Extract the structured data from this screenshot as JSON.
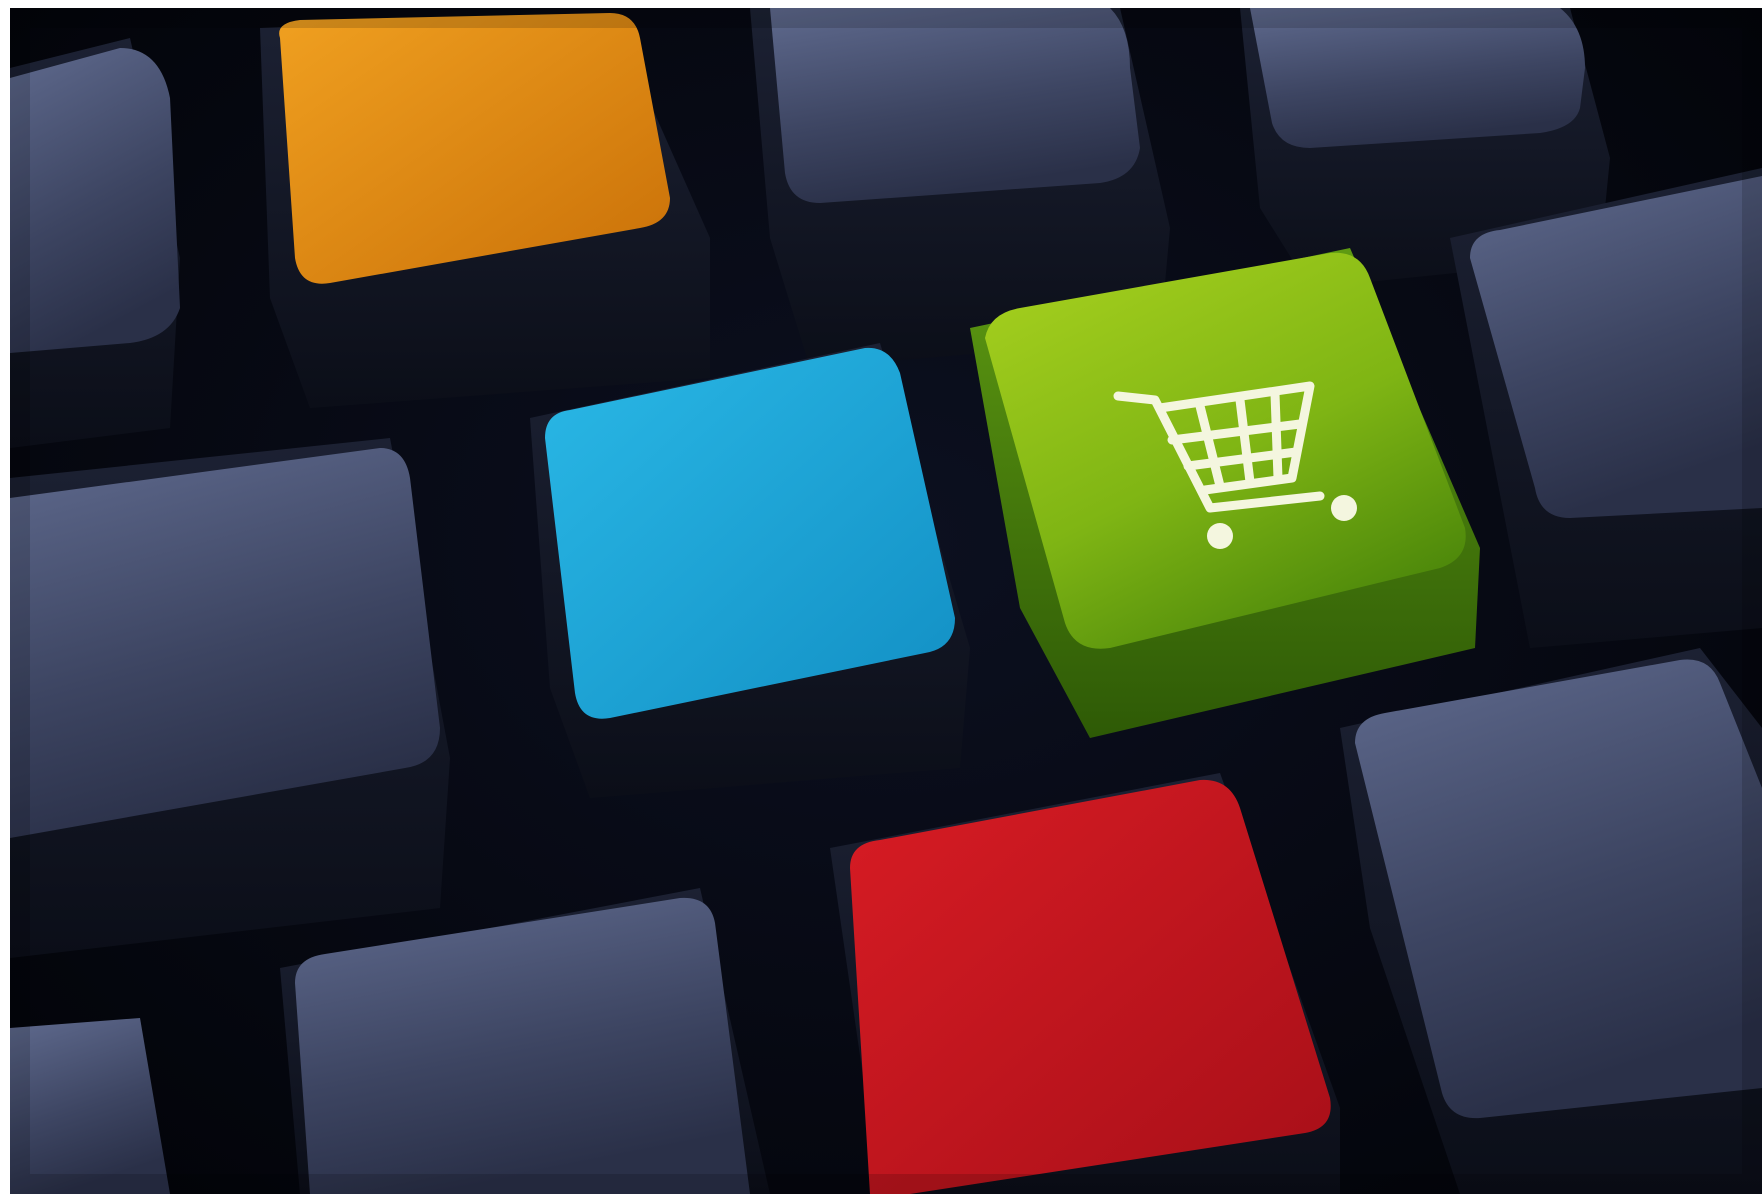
{
  "photo": {
    "subject": "keyboard",
    "keys": [
      {
        "name": "key-orange",
        "color": "#e08a12"
      },
      {
        "name": "key-cyan",
        "color": "#1ea9d9"
      },
      {
        "name": "key-green-cart",
        "color": "#8cc21a",
        "icon": "shopping-cart-icon"
      },
      {
        "name": "key-red",
        "color": "#c8141e"
      },
      {
        "name": "key-slate",
        "color": "#4a5472"
      }
    ],
    "colors": {
      "background": "#05070f",
      "slate_key": "#4a5472",
      "cart_icon": "#ffffff"
    }
  }
}
